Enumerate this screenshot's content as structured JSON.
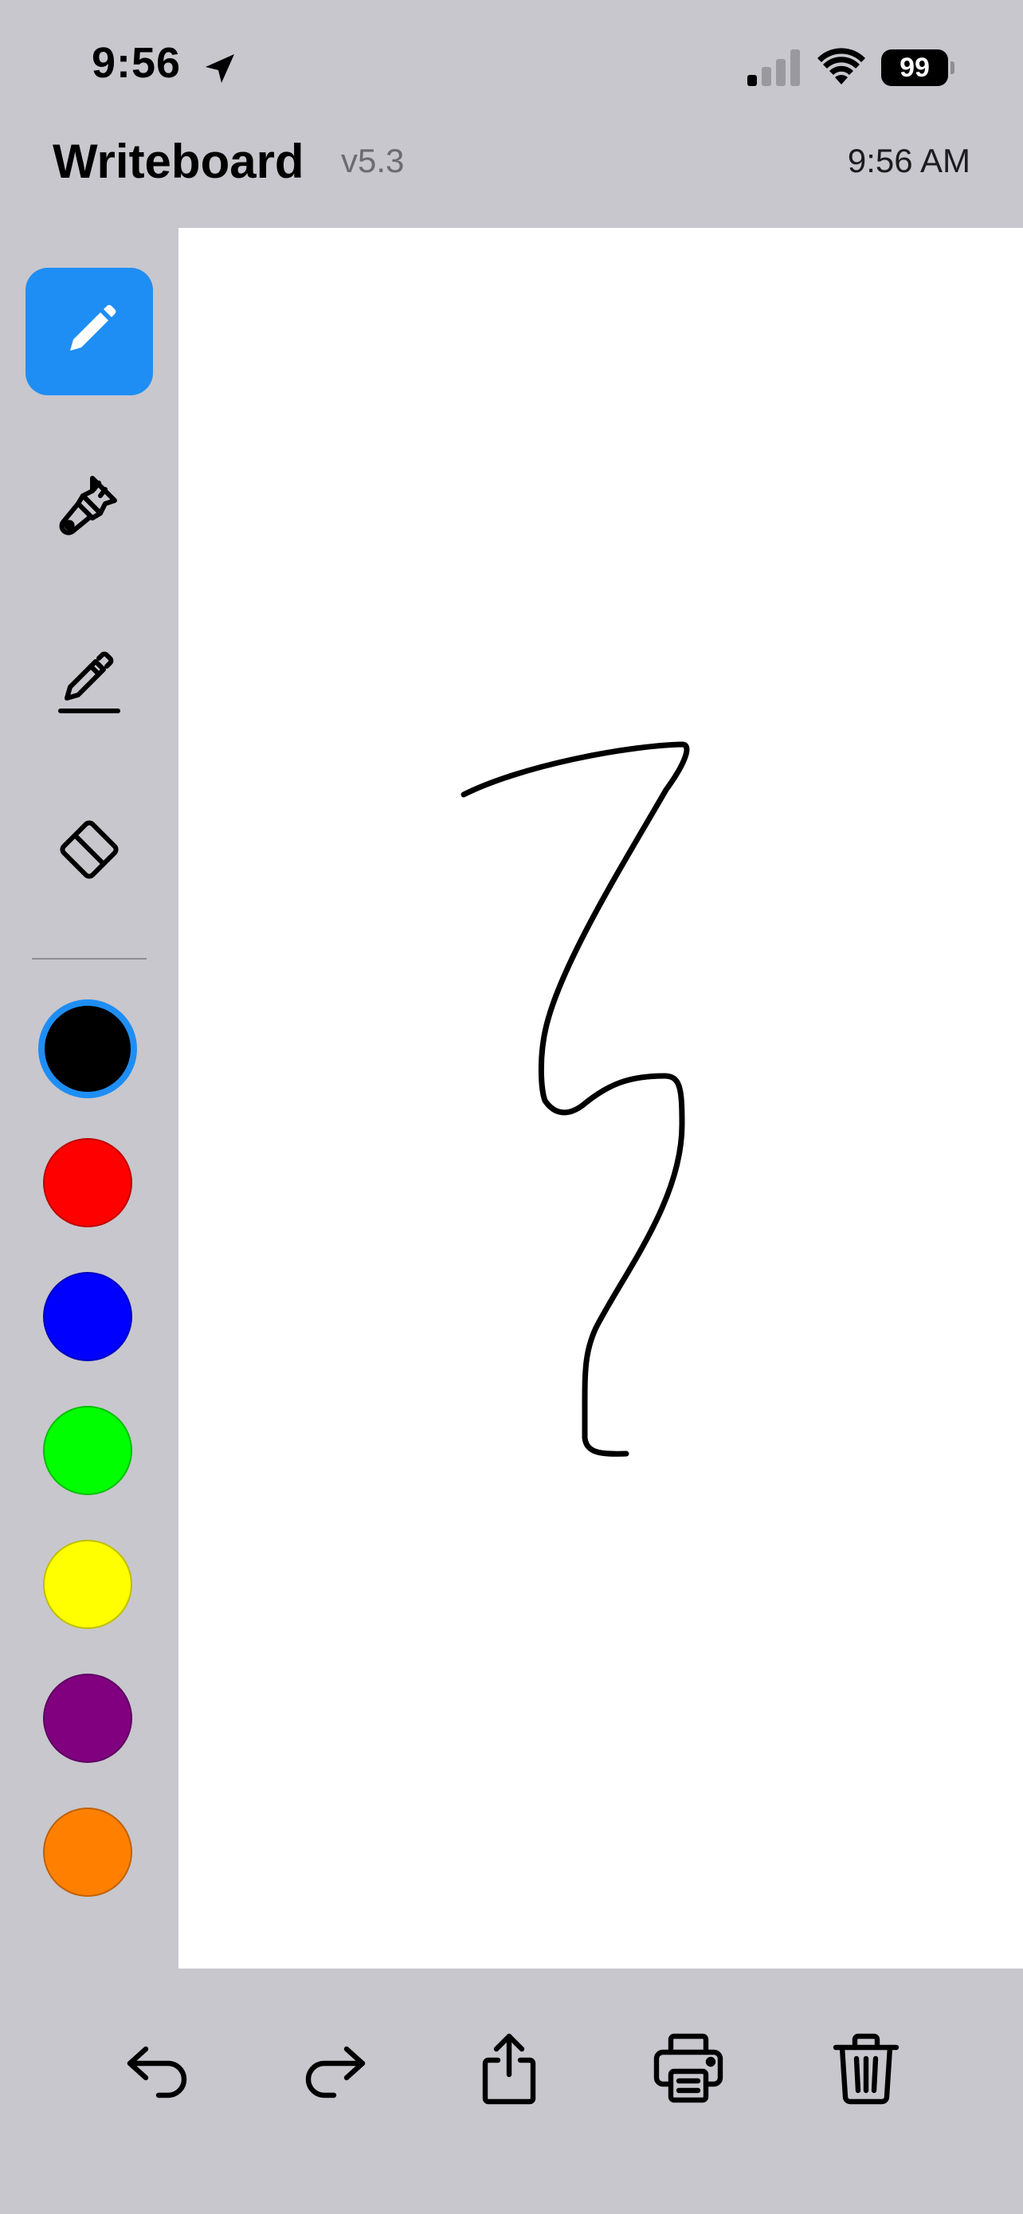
{
  "status_bar": {
    "time": "9:56",
    "battery_level": "99",
    "icons": [
      "location-arrow-icon",
      "cellular-signal-icon",
      "wifi-icon",
      "battery-icon"
    ]
  },
  "header": {
    "title": "Writeboard",
    "version": "v5.3",
    "clock": "9:56 AM"
  },
  "toolbar": {
    "tools": [
      {
        "name": "pen",
        "icon": "pencil-icon",
        "selected": true
      },
      {
        "name": "brush",
        "icon": "paintbrush-icon",
        "selected": false
      },
      {
        "name": "highlighter",
        "icon": "highlighter-icon",
        "selected": false
      },
      {
        "name": "eraser",
        "icon": "eraser-icon",
        "selected": false
      }
    ],
    "colors": [
      {
        "name": "black",
        "hex": "#000000",
        "selected": true
      },
      {
        "name": "red",
        "hex": "#ff0000",
        "selected": false
      },
      {
        "name": "blue",
        "hex": "#0000ff",
        "selected": false
      },
      {
        "name": "green",
        "hex": "#00ff00",
        "selected": false
      },
      {
        "name": "yellow",
        "hex": "#ffff00",
        "selected": false
      },
      {
        "name": "purple",
        "hex": "#800080",
        "selected": false
      },
      {
        "name": "orange",
        "hex": "#ff8000",
        "selected": false
      }
    ],
    "accent": "#1e8ef5"
  },
  "bottom_bar": {
    "actions": [
      {
        "name": "undo",
        "icon": "undo-arrow-icon"
      },
      {
        "name": "redo",
        "icon": "redo-arrow-icon"
      },
      {
        "name": "share",
        "icon": "share-icon"
      },
      {
        "name": "print",
        "icon": "printer-icon"
      },
      {
        "name": "delete",
        "icon": "trash-icon"
      }
    ]
  },
  "canvas": {
    "background": "#ffffff",
    "stroke_color": "#000000"
  }
}
